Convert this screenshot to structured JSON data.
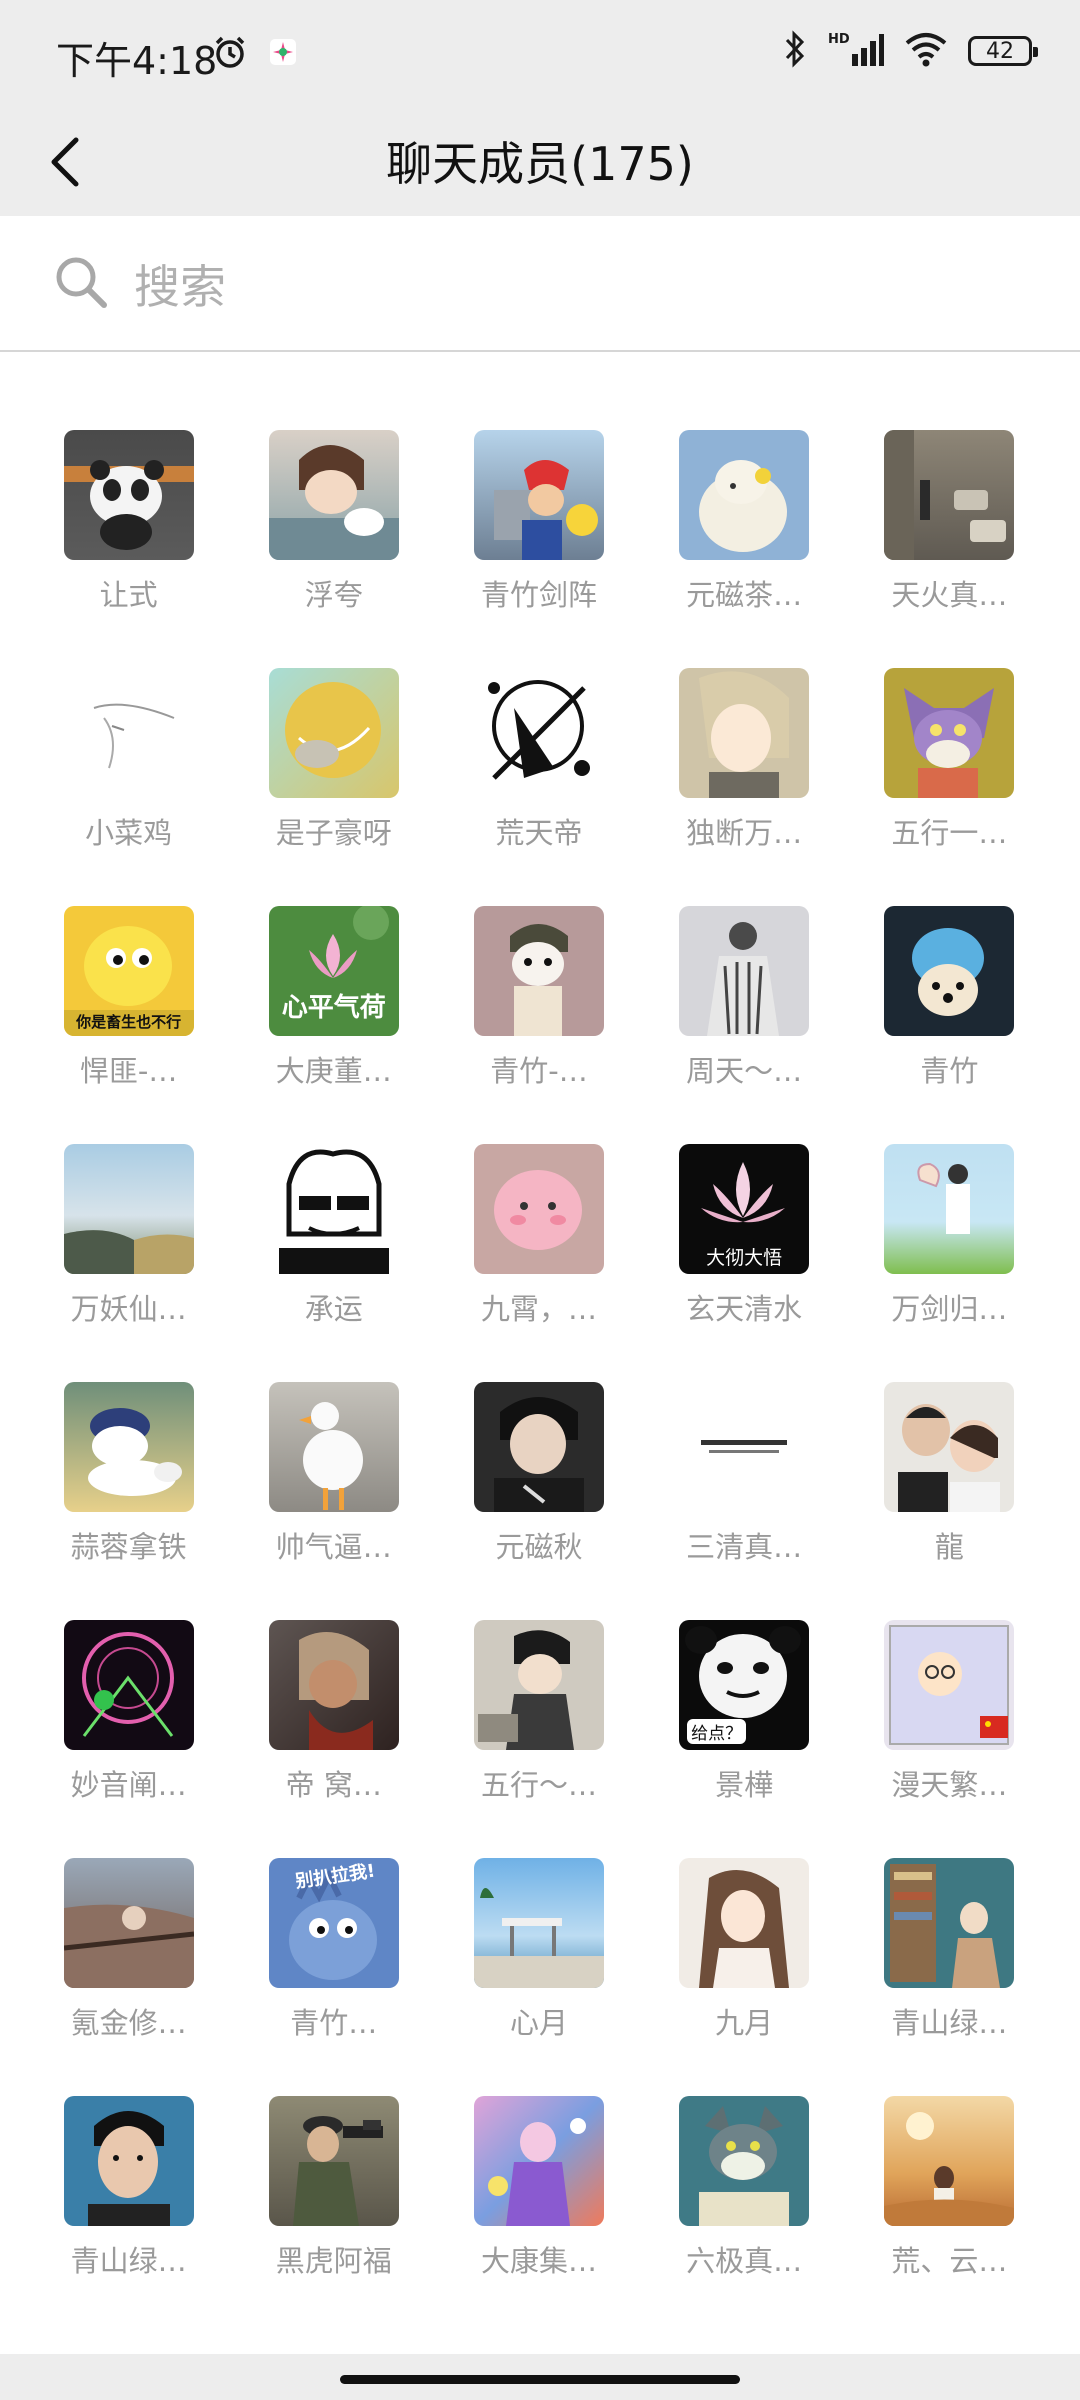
{
  "status_bar": {
    "time": "下午4:18",
    "battery": "42",
    "icons": [
      "alarm-icon",
      "app-notification-icon",
      "bluetooth-icon",
      "signal-hd-icon",
      "wifi-icon",
      "battery-icon"
    ]
  },
  "header": {
    "title": "聊天成员(175)",
    "back_icon": "chevron-left-icon"
  },
  "search": {
    "placeholder": "搜索",
    "icon": "search-icon"
  },
  "members": [
    {
      "name": "让式"
    },
    {
      "name": "浮夸"
    },
    {
      "name": "青竹剑阵"
    },
    {
      "name": "元磁茶…"
    },
    {
      "name": "天火真…"
    },
    {
      "name": "小菜鸡"
    },
    {
      "name": "是子豪呀"
    },
    {
      "name": "荒天帝"
    },
    {
      "name": "独断万…"
    },
    {
      "name": "五行一…"
    },
    {
      "name": "悍匪-…",
      "avatar_caption": "你是畜生也不行"
    },
    {
      "name": "大庚董…",
      "avatar_caption": "心平气荷"
    },
    {
      "name": "青竹-…"
    },
    {
      "name": "周天～…"
    },
    {
      "name": "青竹"
    },
    {
      "name": "万妖仙…"
    },
    {
      "name": "承运"
    },
    {
      "name": "九霄，…"
    },
    {
      "name": "玄天清水",
      "avatar_caption": "大彻大悟"
    },
    {
      "name": "万剑归…"
    },
    {
      "name": "蒜蓉拿铁"
    },
    {
      "name": "帅气逼…"
    },
    {
      "name": "元磁秋"
    },
    {
      "name": "三清真…"
    },
    {
      "name": "龍"
    },
    {
      "name": "妙音阐…"
    },
    {
      "name": "帝 窝…"
    },
    {
      "name": "五行～…"
    },
    {
      "name": "景樺",
      "avatar_caption": "给点？"
    },
    {
      "name": "漫天繁…"
    },
    {
      "name": "氪金修…"
    },
    {
      "name": "青竹…",
      "avatar_caption": "别扒拉我!"
    },
    {
      "name": "心月"
    },
    {
      "name": "九月"
    },
    {
      "name": "青山绿…"
    },
    {
      "name": "青山绿…"
    },
    {
      "name": "黑虎阿福"
    },
    {
      "name": "大康集…"
    },
    {
      "name": "六极真…"
    },
    {
      "name": "荒、云…"
    }
  ]
}
